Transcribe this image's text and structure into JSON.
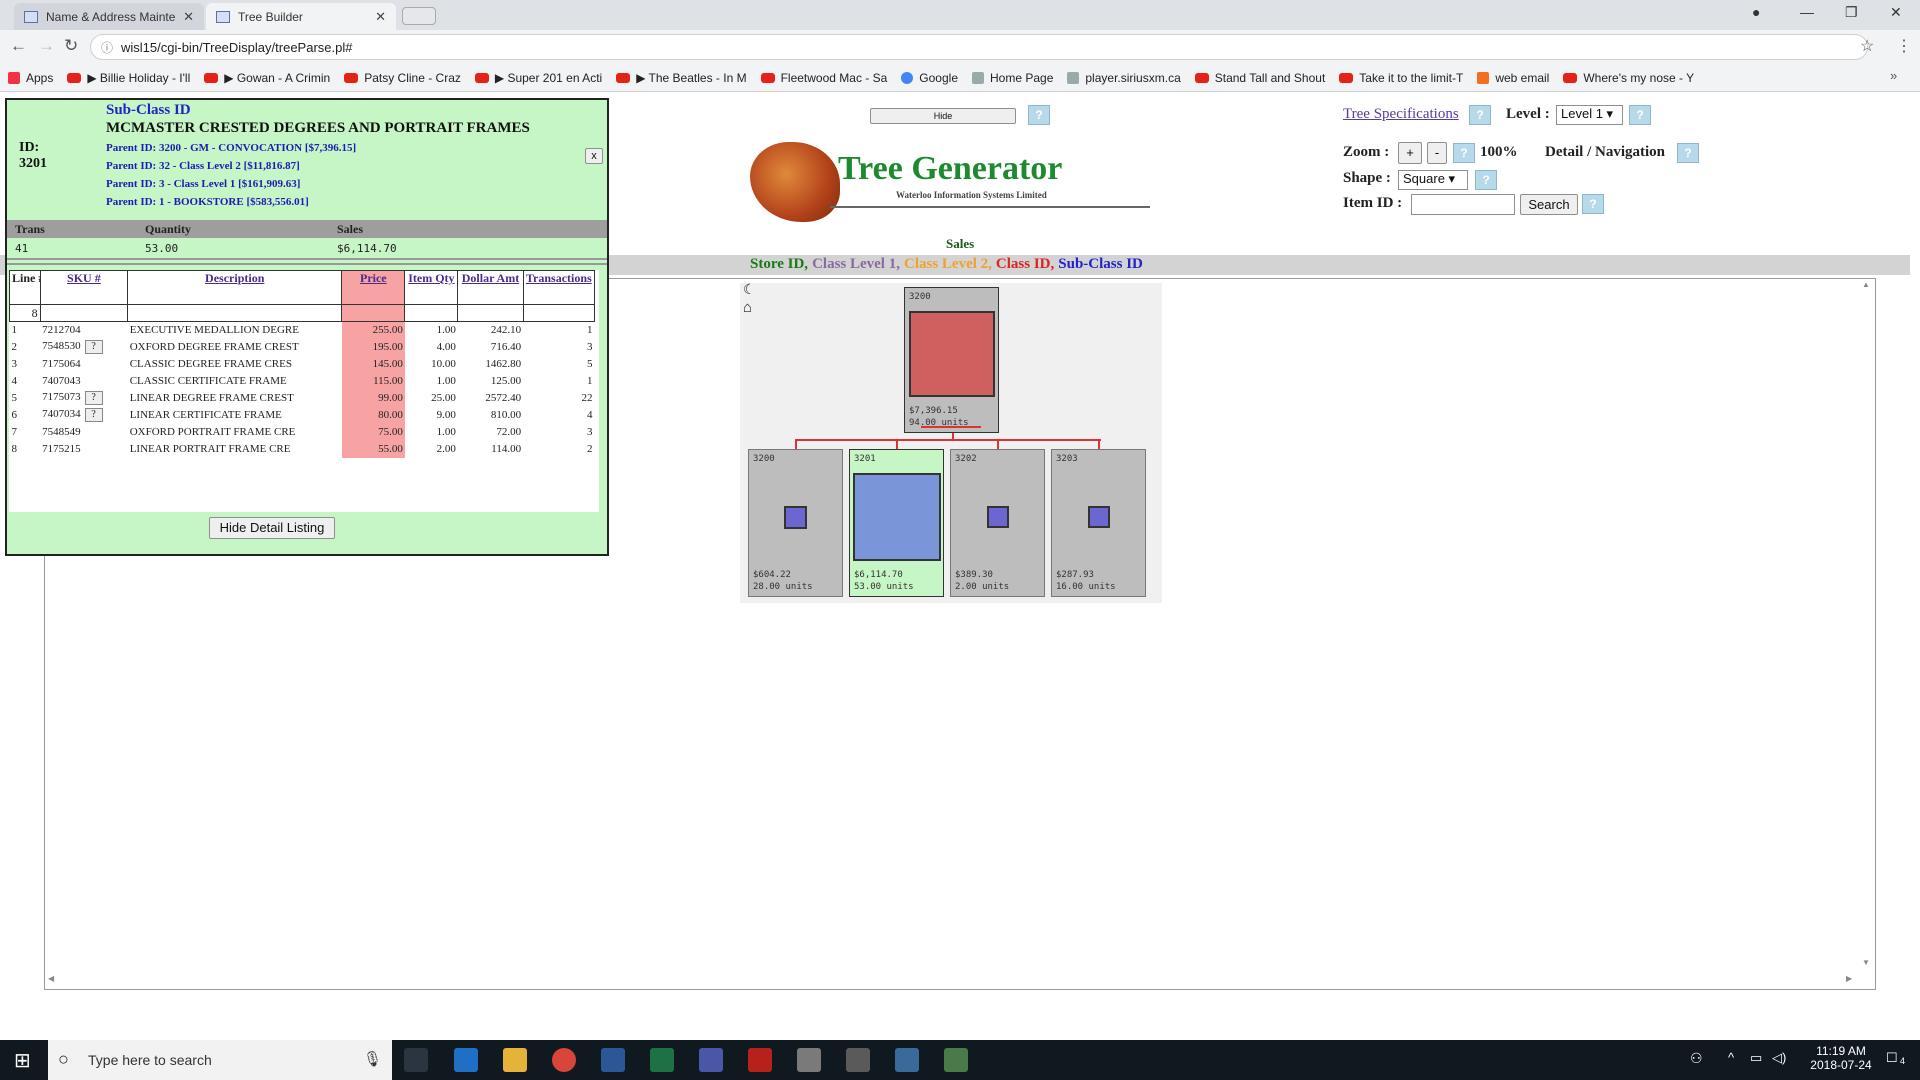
{
  "browser": {
    "tabs": [
      {
        "label": "Name & Address Mainte"
      },
      {
        "label": "Tree Builder"
      }
    ],
    "url": "wisl15/cgi-bin/TreeDisplay/treeParse.pl#",
    "bookmarks": [
      {
        "label": "Apps",
        "icon": "apps-icon"
      },
      {
        "label": "▶ Billie Holiday - I'll",
        "icon": "youtube-icon"
      },
      {
        "label": "▶ Gowan - A Crimin",
        "icon": "youtube-icon"
      },
      {
        "label": "Patsy Cline - Craz",
        "icon": "youtube-icon"
      },
      {
        "label": "▶ Super 201 en Acti",
        "icon": "youtube-icon"
      },
      {
        "label": "▶ The Beatles - In M",
        "icon": "youtube-icon"
      },
      {
        "label": "Fleetwood Mac - Sa",
        "icon": "youtube-icon"
      },
      {
        "label": "Google",
        "icon": "google-icon"
      },
      {
        "label": "Home Page",
        "icon": "wisl-icon"
      },
      {
        "label": "player.siriusxm.ca",
        "icon": "page-icon"
      },
      {
        "label": "Stand Tall and Shout",
        "icon": "red-icon"
      },
      {
        "label": "Take it to the limit-T",
        "icon": "youtube-icon"
      },
      {
        "label": "web email",
        "icon": "cpanel-icon"
      },
      {
        "label": "Where's my nose - Y",
        "icon": "youtube-icon"
      }
    ]
  },
  "controls": {
    "hide_label": "Hide",
    "tree_spec_link": "Tree Specifications",
    "level_label": "Level :",
    "level_value": "Level 1",
    "zoom_label": "Zoom :",
    "zoom_plus": "+",
    "zoom_minus": "-",
    "zoom_value": "100%",
    "detail_nav_label": "Detail / Navigation",
    "shape_label": "Shape :",
    "shape_value": "Square",
    "item_id_label": "Item ID :",
    "search_label": "Search",
    "help": "?"
  },
  "logo": {
    "title": "Tree Generator",
    "subtitle": "Waterloo Information Systems Limited"
  },
  "tree": {
    "metric": "Sales",
    "legend": [
      {
        "label": "Store ID,",
        "color": "#1a7a1a"
      },
      {
        "label": "Class Level 1,",
        "color": "#8a6aa0"
      },
      {
        "label": "Class Level 2,",
        "color": "#f0a030"
      },
      {
        "label": "Class ID,",
        "color": "#dd2222"
      },
      {
        "label": "Sub-Class ID",
        "color": "#2222cc"
      }
    ],
    "root": {
      "id": "3200",
      "sales": "$7,396.15",
      "units": "94.00 units",
      "value": 7396.15
    },
    "children": [
      {
        "id": "3200",
        "sales": "$604.22",
        "units": "28.00 units",
        "value": 604.22
      },
      {
        "id": "3201",
        "sales": "$6,114.70",
        "units": "53.00 units",
        "value": 6114.7
      },
      {
        "id": "3202",
        "sales": "$389.30",
        "units": "2.00 units",
        "value": 389.3
      },
      {
        "id": "3203",
        "sales": "$287.93",
        "units": "16.00 units",
        "value": 287.93
      }
    ]
  },
  "detail": {
    "level_name": "Sub-Class ID",
    "title": "MCMASTER CRESTED DEGREES AND PORTRAIT FRAMES",
    "id_label": "ID:",
    "id_value": "3201",
    "parents": [
      "Parent ID: 3200 - GM - CONVOCATION [$7,396.15]",
      "Parent ID: 32 - Class Level 2 [$11,816.87]",
      "Parent ID: 3 - Class Level 1 [$161,909.63]",
      "Parent ID: 1 - BOOKSTORE [$583,556.01]"
    ],
    "close_label": "x",
    "summary_headers": [
      "Trans",
      "Quantity",
      "Sales"
    ],
    "summary_values": [
      "41",
      "53.00",
      "$6,114.70"
    ],
    "columns": [
      "Line #",
      "SKU #",
      "Description",
      "Price",
      "Item Qty",
      "Dollar Amt",
      "Transactions"
    ],
    "count": "8",
    "rows": [
      {
        "line": "1",
        "sku": "7212704",
        "q": false,
        "desc": "EXECUTIVE MEDALLION DEGRE",
        "price": "255.00",
        "qty": "1.00",
        "amt": "242.10",
        "trans": "1"
      },
      {
        "line": "2",
        "sku": "7548530",
        "q": true,
        "desc": "OXFORD DEGREE FRAME CREST",
        "price": "195.00",
        "qty": "4.00",
        "amt": "716.40",
        "trans": "3"
      },
      {
        "line": "3",
        "sku": "7175064",
        "q": false,
        "desc": "CLASSIC DEGREE FRAME CRES",
        "price": "145.00",
        "qty": "10.00",
        "amt": "1462.80",
        "trans": "5"
      },
      {
        "line": "4",
        "sku": "7407043",
        "q": false,
        "desc": "CLASSIC CERTIFICATE FRAME",
        "price": "115.00",
        "qty": "1.00",
        "amt": "125.00",
        "trans": "1"
      },
      {
        "line": "5",
        "sku": "7175073",
        "q": true,
        "desc": "LINEAR DEGREE FRAME CREST",
        "price": "99.00",
        "qty": "25.00",
        "amt": "2572.40",
        "trans": "22"
      },
      {
        "line": "6",
        "sku": "7407034",
        "q": true,
        "desc": "LINEAR CERTIFICATE FRAME",
        "price": "80.00",
        "qty": "9.00",
        "amt": "810.00",
        "trans": "4"
      },
      {
        "line": "7",
        "sku": "7548549",
        "q": false,
        "desc": "OXFORD PORTRAIT FRAME CRE",
        "price": "75.00",
        "qty": "1.00",
        "amt": "72.00",
        "trans": "3"
      },
      {
        "line": "8",
        "sku": "7175215",
        "q": false,
        "desc": "LINEAR PORTRAIT FRAME CRE",
        "price": "55.00",
        "qty": "2.00",
        "amt": "114.00",
        "trans": "2"
      }
    ],
    "hide_detail_label": "Hide Detail Listing"
  },
  "taskbar": {
    "search_placeholder": "Type here to search",
    "time": "11:19 AM",
    "date": "2018-07-24",
    "notifications": "4"
  }
}
